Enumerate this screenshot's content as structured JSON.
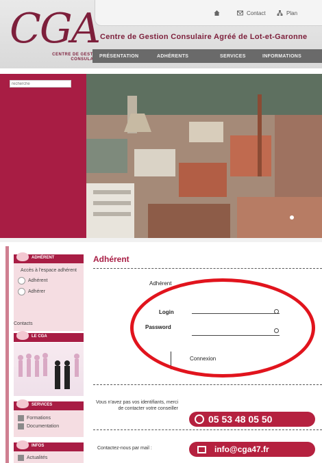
{
  "header": {
    "logo_text": "CGA",
    "logo_subtext": "CENTRE DE GESTION CONSULAIRE",
    "site_title": "Centre de Gestion Consulaire Agréé de Lot-et-Garonne",
    "top_links": {
      "home_icon": "home-icon",
      "contact": "Contact",
      "plan": "Plan"
    }
  },
  "nav": {
    "items": [
      "Présentation",
      "Adhérents",
      "Services",
      "Informations"
    ]
  },
  "banner": {
    "search_placeholder": "recherche",
    "accent_color": "#a81d44"
  },
  "sidebar": {
    "box1": {
      "title": "Adhérent",
      "body": "Accès à l'espace adhérent",
      "link1": "Adhérent",
      "link2": "Adhérer",
      "footer": "Contacts"
    },
    "box2": {
      "title": "Le CGA"
    },
    "box3": {
      "title": "Services",
      "row1": "Formations",
      "row2": "Documentation"
    },
    "box4": {
      "title": "Infos",
      "row1": "Actualités"
    }
  },
  "main": {
    "title": "Adhérent",
    "adherent_label": "Adhérent",
    "login_label": "Login",
    "password_label": "Password",
    "connect_label": "Connexion",
    "help_text": "Vous n'avez pas vos identifiants, merci de contacter votre conseiller",
    "phone": "05 53 48 05 50",
    "email_text": "Contactez-nous par mail :",
    "email": "info@cga47.fr"
  }
}
